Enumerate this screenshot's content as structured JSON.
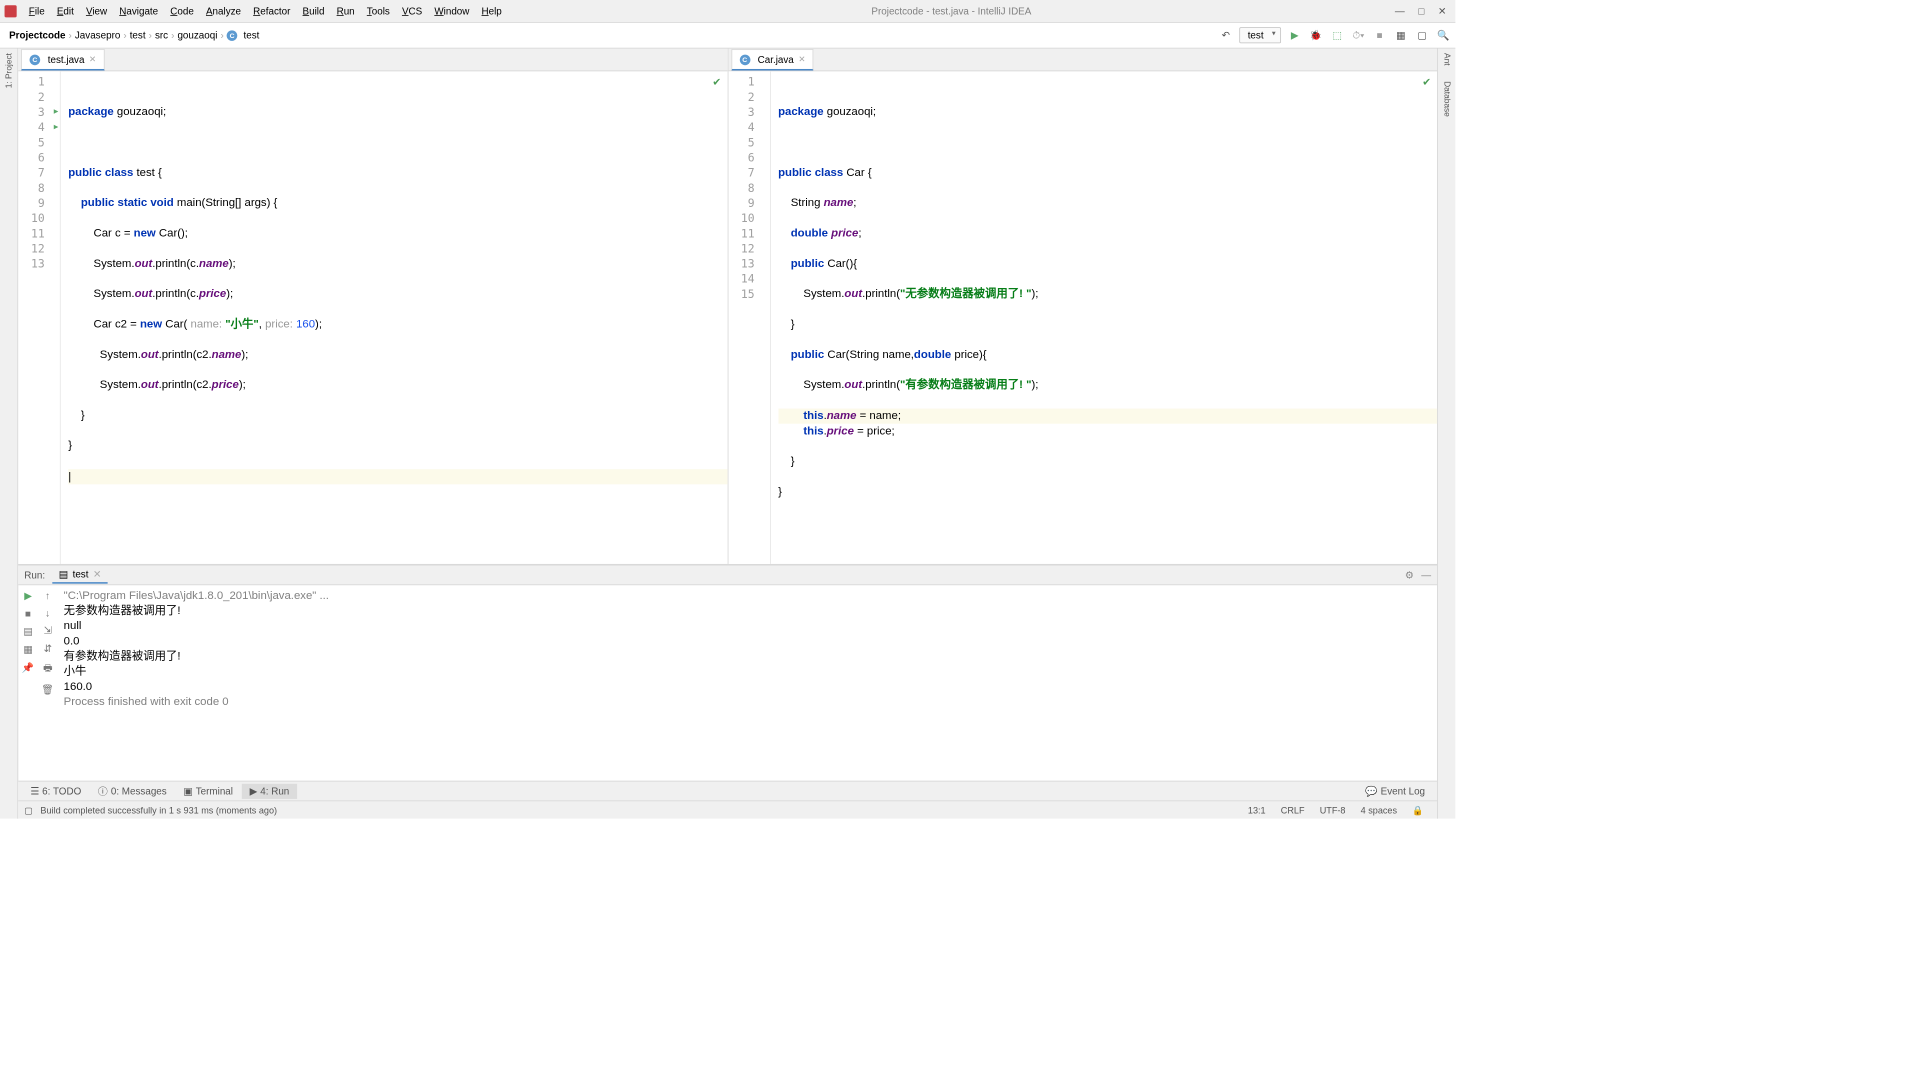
{
  "window_title": "Projectcode - test.java - IntelliJ IDEA",
  "menu": [
    "File",
    "Edit",
    "View",
    "Navigate",
    "Code",
    "Analyze",
    "Refactor",
    "Build",
    "Run",
    "Tools",
    "VCS",
    "Window",
    "Help"
  ],
  "breadcrumb": [
    "Projectcode",
    "Javasepro",
    "test",
    "src",
    "gouzaoqi",
    "test"
  ],
  "run_config": "test",
  "left_tool": {
    "project": "1: Project"
  },
  "right_tool": {
    "ant": "Ant",
    "db": "Database"
  },
  "editor_left": {
    "tab": "test.java",
    "lines": [
      "1",
      "2",
      "3",
      "4",
      "5",
      "6",
      "7",
      "8",
      "9",
      "10",
      "11",
      "12",
      "13"
    ],
    "runmarks": [
      3,
      4
    ],
    "code": {
      "l1a": "package",
      "l1b": " gouzaoqi;",
      "l3": "public class ",
      "l3b": "test {",
      "l4": "    public static void ",
      "l4b": "main(String[] args) {",
      "l5": "        Car c = ",
      "l5b": "new",
      "l5c": " Car();",
      "l6": "        System.",
      "l6b": "out",
      "l6c": ".println(c.",
      "l6d": "name",
      "l6e": ");",
      "l7": "        System.",
      "l7b": "out",
      "l7c": ".println(c.",
      "l7d": "price",
      "l7e": ");",
      "l8": "        Car c2 = ",
      "l8b": "new",
      "l8c": " Car( ",
      "l8h1": "name: ",
      "l8s": "\"小牛\"",
      "l8d": ", ",
      "l8h2": "price: ",
      "l8n": "160",
      "l8e": ");",
      "l9": "          System.",
      "l9b": "out",
      "l9c": ".println(c2.",
      "l9d": "name",
      "l9e": ");",
      "l10": "          System.",
      "l10b": "out",
      "l10c": ".println(c2.",
      "l10d": "price",
      "l10e": ");",
      "l11": "    }",
      "l12": "}",
      "l13": "|"
    }
  },
  "editor_right": {
    "tab": "Car.java",
    "lines": [
      "1",
      "2",
      "3",
      "4",
      "5",
      "6",
      "7",
      "8",
      "9",
      "10",
      "11",
      "12",
      "13",
      "14",
      "15"
    ],
    "code": {
      "l1a": "package",
      "l1b": " gouzaoqi;",
      "l3": "public class ",
      "l3b": "Car {",
      "l4": "    String ",
      "l4b": "name",
      "l4c": ";",
      "l5": "    ",
      "l5a": "double ",
      "l5b": "price",
      "l5c": ";",
      "l6": "    ",
      "l6a": "public",
      "l6b": " Car(){",
      "l7": "        System.",
      "l7b": "out",
      "l7c": ".println(",
      "l7s": "\"无参数构造器被调用了! \"",
      "l7e": ");",
      "l8": "    }",
      "l9": "    ",
      "l9a": "public",
      "l9b": " Car(String name,",
      "l9c": "double",
      "l9d": " price){",
      "l10": "        System.",
      "l10b": "out",
      "l10c": ".println(",
      "l10s": "\"有参数构造器被调用了! \"",
      "l10e": ");",
      "l11": "        ",
      "l11a": "this",
      "l11b": ".",
      "l11c": "name",
      "l11d": " = name;",
      "l12": "        ",
      "l12a": "this",
      "l12b": ".",
      "l12c": "price",
      "l12d": " = price;",
      "l13": "    }",
      "l14": "}"
    }
  },
  "run": {
    "label": "Run:",
    "tab": "test",
    "output": [
      {
        "t": "\"C:\\Program Files\\Java\\jdk1.8.0_201\\bin\\java.exe\" ...",
        "dim": true
      },
      {
        "t": "无参数构造器被调用了! "
      },
      {
        "t": "null"
      },
      {
        "t": "0.0"
      },
      {
        "t": "有参数构造器被调用了! "
      },
      {
        "t": "小牛"
      },
      {
        "t": "160.0"
      },
      {
        "t": ""
      },
      {
        "t": "Process finished with exit code 0",
        "dim": true
      }
    ]
  },
  "bottom_tools": {
    "todo": "6: TODO",
    "msg": "0: Messages",
    "term": "Terminal",
    "run": "4: Run",
    "event": "Event Log"
  },
  "status": {
    "msg": "Build completed successfully in 1 s 931 ms (moments ago)",
    "pos": "13:1",
    "crlf": "CRLF",
    "enc": "UTF-8",
    "indent": "4 spaces"
  }
}
